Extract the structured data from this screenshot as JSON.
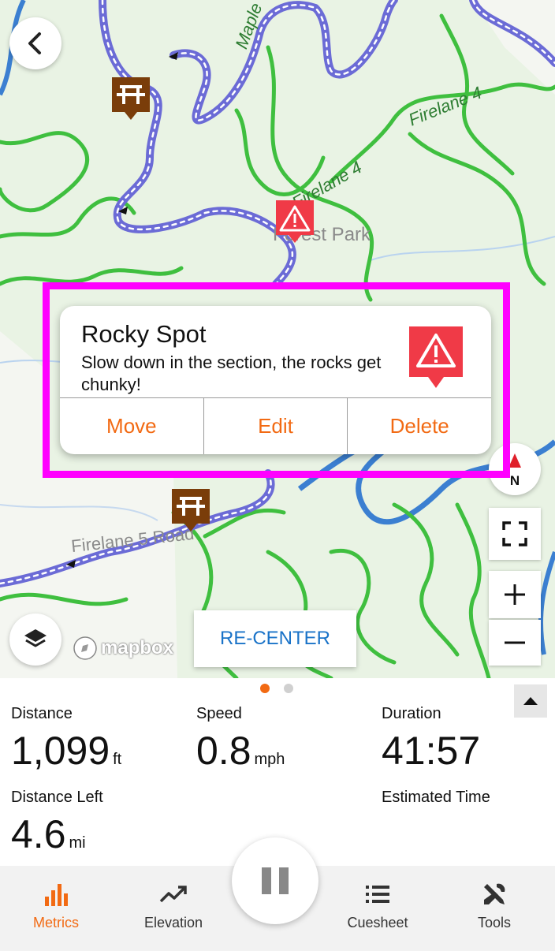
{
  "colors": {
    "accent": "#f26a13",
    "hazard": "#f03a47",
    "poi": "#7a3d0a",
    "route": "#6b6bd6",
    "trail": "#3fbf3f",
    "water": "#3b7fd1",
    "highlight": "#ff00ff",
    "link": "#1a73c8"
  },
  "map": {
    "labels": [
      "Maple",
      "Firelane 4",
      "Firelane 4",
      "Forest Park",
      "Firelane 5 Road"
    ],
    "attribution": "mapbox",
    "recenter_label": "RE-CENTER",
    "compass_label": "N"
  },
  "popup": {
    "title": "Rocky Spot",
    "description": "Slow down in the section, the rocks get chunky!",
    "icon": "hazard-warning-icon",
    "actions": [
      "Move",
      "Edit",
      "Delete"
    ]
  },
  "metrics": {
    "distance": {
      "label": "Distance",
      "value": "1,099",
      "unit": "ft"
    },
    "speed": {
      "label": "Speed",
      "value": "0.8",
      "unit": "mph"
    },
    "duration": {
      "label": "Duration",
      "value": "41:57"
    },
    "distance_left": {
      "label": "Distance Left",
      "value": "4.6",
      "unit": "mi"
    },
    "estimated_time": {
      "label": "Estimated Time",
      "value": ""
    }
  },
  "pager": {
    "pages": 2,
    "current": 1
  },
  "tabs": [
    {
      "label": "Metrics",
      "icon": "bar-chart-icon",
      "active": true
    },
    {
      "label": "Elevation",
      "icon": "trend-up-icon",
      "active": false
    },
    {
      "label": "Cuesheet",
      "icon": "list-icon",
      "active": false
    },
    {
      "label": "Tools",
      "icon": "tools-icon",
      "active": false
    }
  ]
}
